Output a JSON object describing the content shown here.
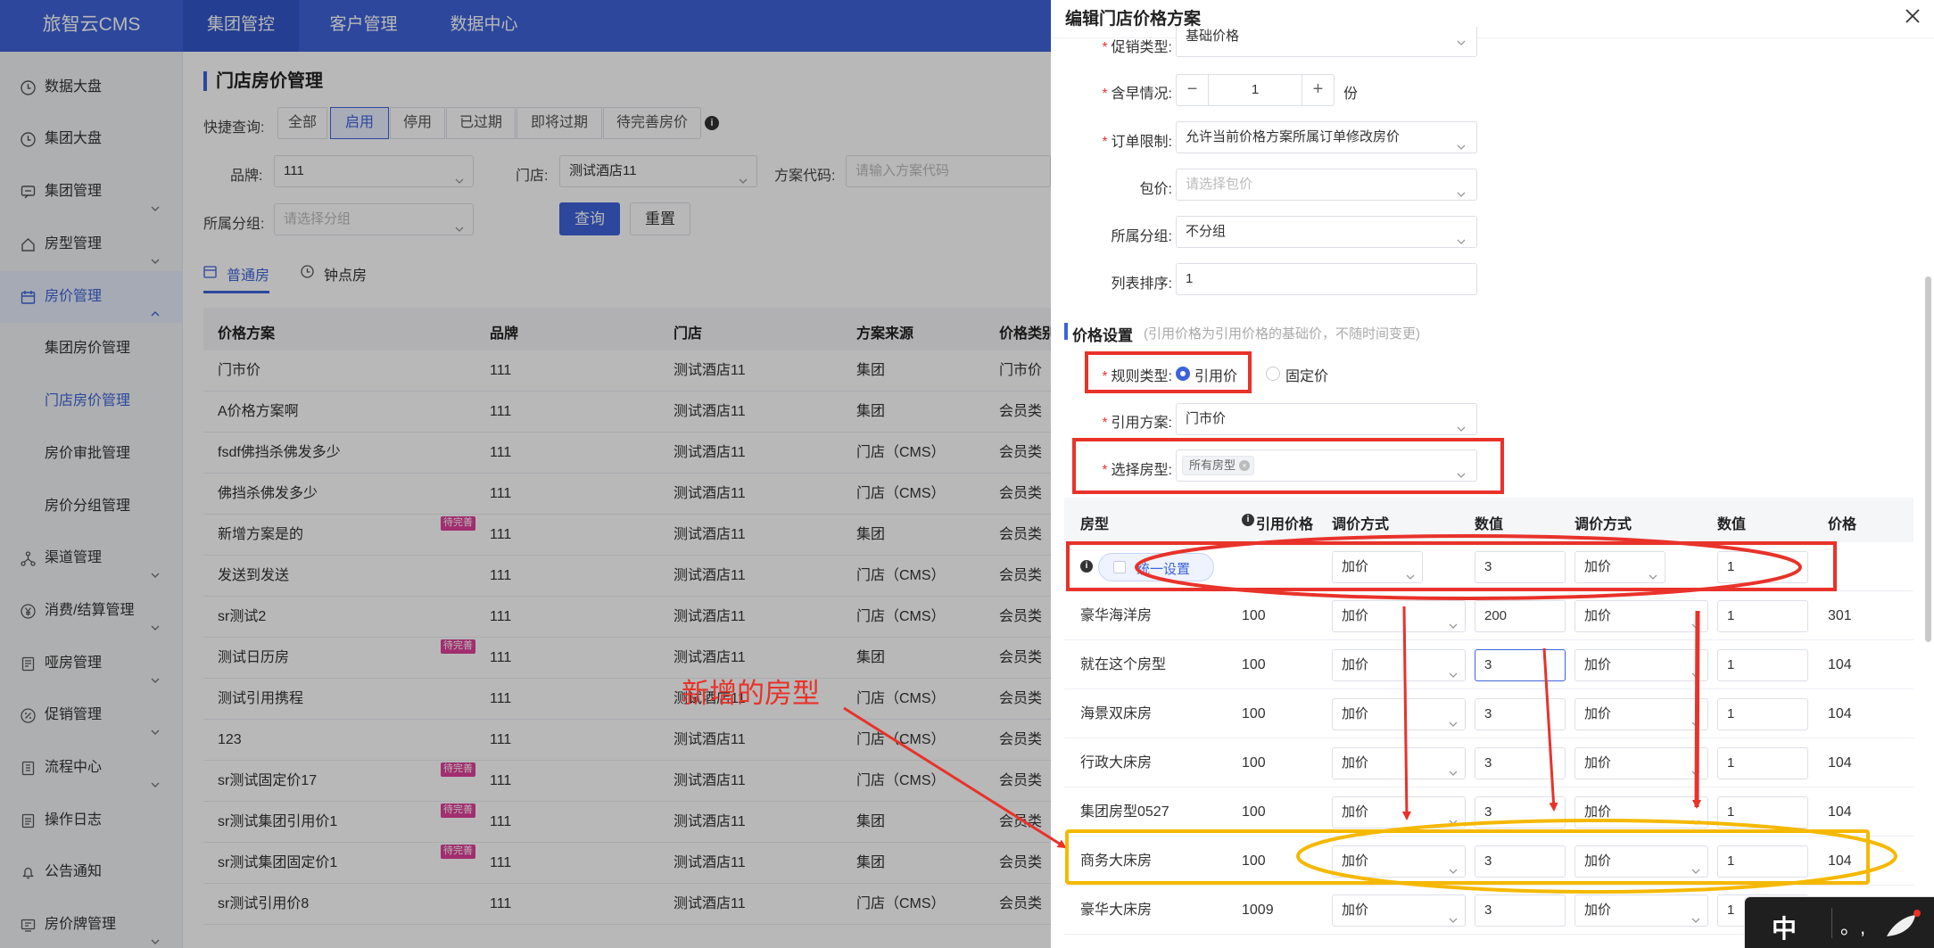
{
  "app": {
    "logo": "旅智云CMS",
    "nav": [
      "集团管控",
      "客户管理",
      "数据中心"
    ]
  },
  "sidebar": {
    "items": [
      {
        "label": "数据大盘",
        "icon": "clock-icon"
      },
      {
        "label": "集团大盘",
        "icon": "clock-icon"
      },
      {
        "label": "集团管理",
        "icon": "message-icon"
      },
      {
        "label": "房型管理",
        "icon": "home-icon"
      },
      {
        "label": "房价管理",
        "icon": "calendar-icon"
      }
    ],
    "subitems": [
      "集团房价管理",
      "门店房价管理",
      "房价审批管理",
      "房价分组管理"
    ],
    "items2": [
      {
        "label": "渠道管理",
        "icon": "network-icon"
      },
      {
        "label": "消费/结算管理",
        "icon": "yen-icon"
      },
      {
        "label": "哑房管理",
        "icon": "document-icon"
      },
      {
        "label": "促销管理",
        "icon": "percent-icon"
      },
      {
        "label": "流程中心",
        "icon": "flow-icon"
      },
      {
        "label": "操作日志",
        "icon": "log-icon"
      },
      {
        "label": "公告通知",
        "icon": "bell-icon"
      },
      {
        "label": "房价牌管理",
        "icon": "board-icon"
      }
    ]
  },
  "main": {
    "title": "门店房价管理",
    "quick_label": "快捷查询:",
    "quick": [
      "全部",
      "启用",
      "停用",
      "已过期",
      "即将过期",
      "待完善房价"
    ],
    "brand_label": "品牌:",
    "brand_value": "111",
    "store_label": "门店:",
    "store_value": "测试酒店11",
    "code_label": "方案代码:",
    "code_placeholder": "请输入方案代码",
    "group_label": "所属分组:",
    "group_placeholder": "请选择分组",
    "query": "查询",
    "reset": "重置",
    "tabs": [
      "普通房",
      "钟点房"
    ],
    "headers": [
      "价格方案",
      "品牌",
      "门店",
      "方案来源",
      "价格类别"
    ],
    "tag": "待完善",
    "rows": [
      {
        "name": "门市价",
        "brand": "111",
        "store": "测试酒店11",
        "source": "集团",
        "cat": "门市价",
        "tag": false
      },
      {
        "name": "A价格方案啊",
        "brand": "111",
        "store": "测试酒店11",
        "source": "集团",
        "cat": "会员类",
        "tag": false
      },
      {
        "name": "fsdf佛挡杀佛发多少",
        "brand": "111",
        "store": "测试酒店11",
        "source": "门店（CMS）",
        "cat": "会员类",
        "tag": false
      },
      {
        "name": "佛挡杀佛发多少",
        "brand": "111",
        "store": "测试酒店11",
        "source": "门店（CMS）",
        "cat": "会员类",
        "tag": false
      },
      {
        "name": "新增方案是的",
        "brand": "111",
        "store": "测试酒店11",
        "source": "集团",
        "cat": "会员类",
        "tag": true
      },
      {
        "name": "发送到发送",
        "brand": "111",
        "store": "测试酒店11",
        "source": "门店（CMS）",
        "cat": "会员类",
        "tag": false
      },
      {
        "name": "sr测试2",
        "brand": "111",
        "store": "测试酒店11",
        "source": "门店（CMS）",
        "cat": "会员类",
        "tag": false
      },
      {
        "name": "测试日历房",
        "brand": "111",
        "store": "测试酒店11",
        "source": "集团",
        "cat": "会员类",
        "tag": true
      },
      {
        "name": "测试引用携程",
        "brand": "111",
        "store": "测试酒店11",
        "source": "门店（CMS）",
        "cat": "会员类",
        "tag": false
      },
      {
        "name": "123",
        "brand": "111",
        "store": "测试酒店11",
        "source": "门店（CMS）",
        "cat": "会员类",
        "tag": false
      },
      {
        "name": "sr测试固定价17",
        "brand": "111",
        "store": "测试酒店11",
        "source": "门店（CMS）",
        "cat": "会员类",
        "tag": true
      },
      {
        "name": "sr测试集团引用价1",
        "brand": "111",
        "store": "测试酒店11",
        "source": "集团",
        "cat": "会员类",
        "tag": true
      },
      {
        "name": "sr测试集团固定价1",
        "brand": "111",
        "store": "测试酒店11",
        "source": "集团",
        "cat": "会员类",
        "tag": true
      },
      {
        "name": "sr测试引用价8",
        "brand": "111",
        "store": "测试酒店11",
        "source": "门店（CMS）",
        "cat": "会员类",
        "tag": false
      }
    ]
  },
  "drawer": {
    "title": "编辑门店价格方案",
    "promo_label": "促销类型:",
    "promo_value": "基础价格",
    "breakfast_label": "含早情况:",
    "breakfast_value": "1",
    "breakfast_unit": "份",
    "order_label": "订单限制:",
    "order_value": "允许当前价格方案所属订单修改房价",
    "package_label": "包价:",
    "package_placeholder": "请选择包价",
    "group_label": "所属分组:",
    "group_value": "不分组",
    "sort_label": "列表排序:",
    "sort_value": "1",
    "section_title": "价格设置",
    "section_hint": "(引用价格为引用价格的基础价，不随时间变更)",
    "rule_label": "规则类型:",
    "rule_options": [
      "引用价",
      "固定价"
    ],
    "ref_label": "引用方案:",
    "ref_value": "门市价",
    "room_label": "选择房型:",
    "room_tag": "所有房型",
    "headers": [
      "房型",
      "引用价格",
      "调价方式",
      "数值",
      "调价方式",
      "数值",
      "价格"
    ],
    "unify_label": "统一设置",
    "unify": {
      "m1": "加价",
      "v1": "3",
      "m2": "加价",
      "v2": "1"
    },
    "rows": [
      {
        "room": "豪华海洋房",
        "ref": "100",
        "m1": "加价",
        "v1": "200",
        "m2": "加价",
        "v2": "1",
        "price": "301"
      },
      {
        "room": "就在这个房型",
        "ref": "100",
        "m1": "加价",
        "v1": "3",
        "m2": "加价",
        "v2": "1",
        "price": "104"
      },
      {
        "room": "海景双床房",
        "ref": "100",
        "m1": "加价",
        "v1": "3",
        "m2": "加价",
        "v2": "1",
        "price": "104"
      },
      {
        "room": "行政大床房",
        "ref": "100",
        "m1": "加价",
        "v1": "3",
        "m2": "加价",
        "v2": "1",
        "price": "104"
      },
      {
        "room": "集团房型0527",
        "ref": "100",
        "m1": "加价",
        "v1": "3",
        "m2": "加价",
        "v2": "1",
        "price": "104"
      },
      {
        "room": "商务大床房",
        "ref": "100",
        "m1": "加价",
        "v1": "3",
        "m2": "加价",
        "v2": "1",
        "price": "104"
      },
      {
        "room": "豪华大床房",
        "ref": "1009",
        "m1": "加价",
        "v1": "3",
        "m2": "加价",
        "v2": "1",
        "price": ""
      }
    ]
  },
  "annotation": {
    "text": "新增的房型",
    "red": "#e8322a",
    "yellow": "#f5b800"
  },
  "ime": {
    "char": "中",
    "punct": "。,"
  },
  "colors": {
    "primary": "#3d63d9",
    "tag_pink": "#e0409a"
  }
}
